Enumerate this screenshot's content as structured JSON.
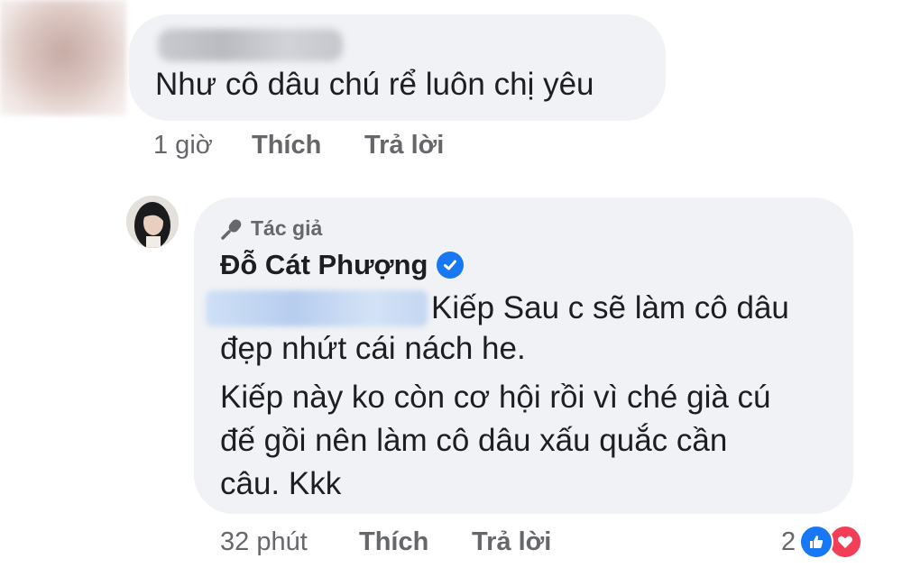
{
  "colors": {
    "bubble_bg": "#f0f2f5",
    "meta_text": "#65676b",
    "primary_text": "#1c1e21",
    "verified_blue": "#1877f2",
    "like_blue": "#1877f2",
    "love_red": "#f33e58"
  },
  "comment": {
    "text": "Như cô dâu chú rể luôn chị yêu",
    "time": "1 giờ",
    "like_label": "Thích",
    "reply_label": "Trả lời"
  },
  "reply": {
    "author_tag": "Tác giả",
    "author_tag_icon": "microphone-icon",
    "author_name": "Đỗ Cát Phượng",
    "verified_icon": "verified-badge-icon",
    "lines": [
      "Kiếp Sau c sẽ làm cô dâu",
      "đẹp nhứt cái nách he.",
      "Kiếp này ko còn cơ hội rồi vì ché già cú",
      "đế gồi nên làm cô dâu xấu quắc cần",
      "câu. Kkk"
    ],
    "time": "32 phút",
    "like_label": "Thích",
    "reply_label": "Trả lời",
    "reaction_count": "2",
    "reaction_icons": [
      "like-icon",
      "love-icon"
    ]
  }
}
